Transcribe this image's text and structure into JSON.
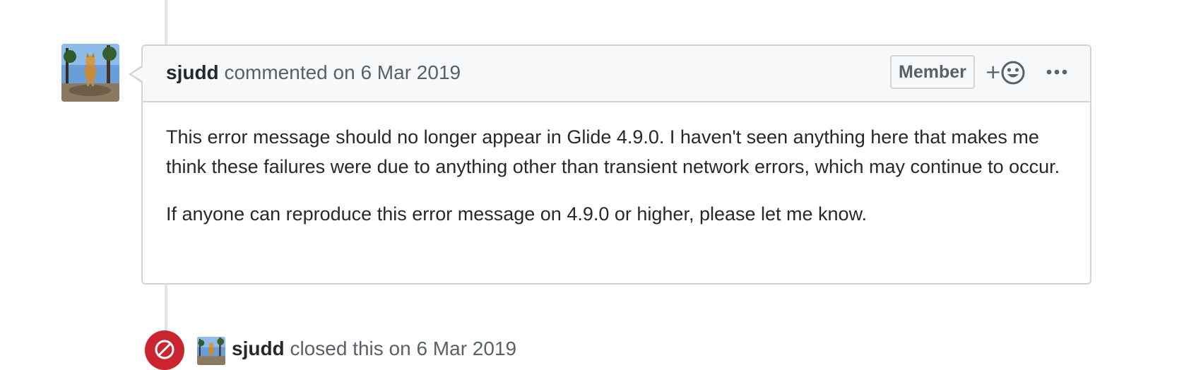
{
  "comment": {
    "author": "sjudd",
    "action": "commented on",
    "date": "6 Mar 2019",
    "badge": "Member",
    "reaction_plus": "+",
    "paragraphs": [
      "This error message should no longer appear in Glide 4.9.0. I haven't seen anything here that makes me think these failures were due to anything other than transient network errors, which may continue to occur.",
      "If anyone can reproduce this error message on 4.9.0 or higher, please let me know."
    ]
  },
  "event": {
    "author": "sjudd",
    "action": "closed this on",
    "date": "6 Mar 2019",
    "icon": "closed-issue-icon",
    "status_color": "#cb2431"
  },
  "icons": {
    "reaction": "smiley-icon",
    "more": "kebab-horizontal-icon"
  }
}
